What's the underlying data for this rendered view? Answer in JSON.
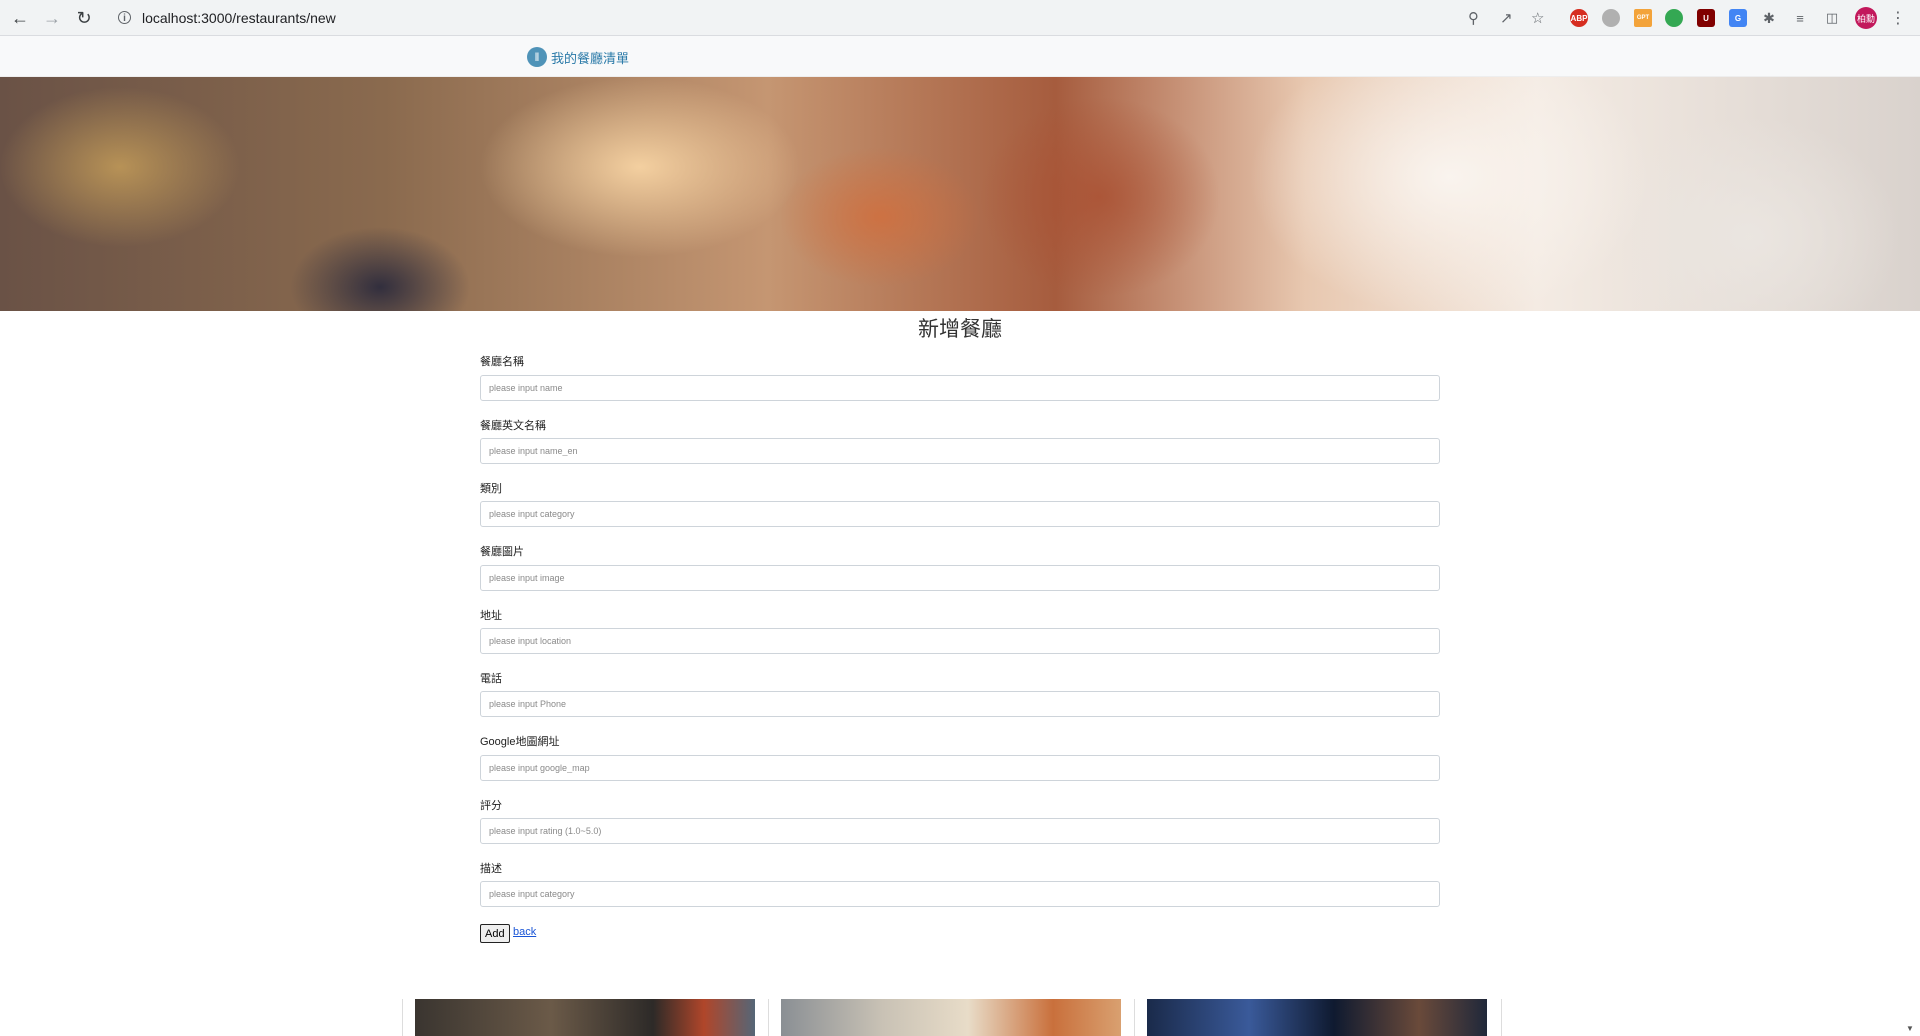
{
  "browser": {
    "url": "localhost:3000/restaurants/new",
    "profile_label": "柏勳",
    "extensions": [
      "ABP",
      "web-icon",
      "Start GPT",
      "chrome-icon",
      "uBlock",
      "translate-icon",
      "puzzle-icon",
      "playlist-icon",
      "sidepanel-icon"
    ]
  },
  "navbar": {
    "brand": "我的餐廳清單"
  },
  "page": {
    "title": "新增餐廳"
  },
  "form": {
    "fields": [
      {
        "label": "餐廳名稱",
        "placeholder": "please input name"
      },
      {
        "label": "餐廳英文名稱",
        "placeholder": "please input name_en"
      },
      {
        "label": "類別",
        "placeholder": "please input category"
      },
      {
        "label": "餐廳圖片",
        "placeholder": "please input image"
      },
      {
        "label": "地址",
        "placeholder": "please input location"
      },
      {
        "label": "電話",
        "placeholder": "please input Phone"
      },
      {
        "label": "Google地圖網址",
        "placeholder": "please input google_map"
      },
      {
        "label": "評分",
        "placeholder": "please input rating (1.0~5.0)"
      },
      {
        "label": "描述",
        "placeholder": "please input category"
      }
    ],
    "submit_label": "Add",
    "back_label": "back"
  }
}
